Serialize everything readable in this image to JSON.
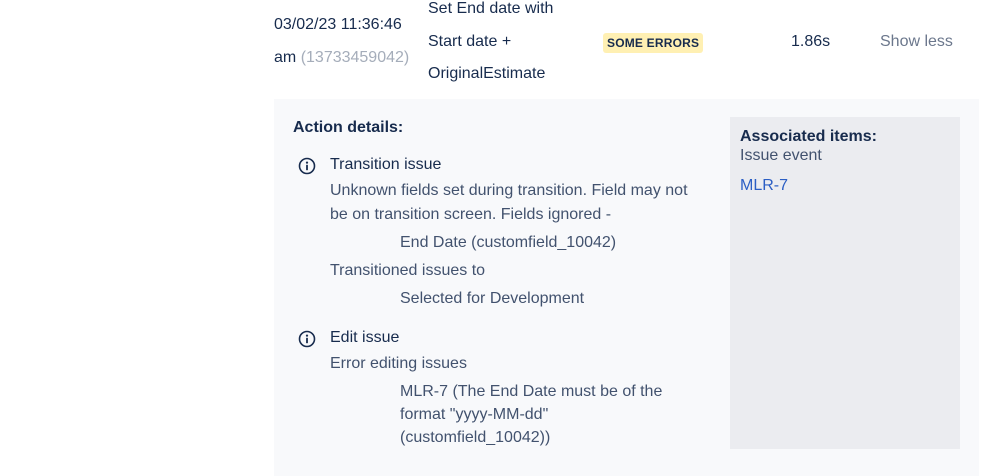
{
  "row": {
    "date": "03/02/23 11:36:46",
    "time_suffix": "am",
    "execution_id": "(13733459042)",
    "rule_name_lines": [
      "Set End date with",
      "Start date +",
      "OriginalEstimate"
    ],
    "status": "SOME ERRORS",
    "duration": "1.86s",
    "toggle_label": "Show less"
  },
  "details": {
    "title": "Action details:",
    "actions": [
      {
        "icon": "info-icon",
        "title": "Transition issue",
        "messages": [
          "Unknown fields set during transition. Field may not",
          "be on transition screen. Fields ignored -"
        ],
        "detail1": "End Date (customfield_10042)",
        "message2": "Transitioned issues to",
        "detail2": "Selected for Development"
      },
      {
        "icon": "info-icon",
        "title": "Edit issue",
        "message": "Error editing issues",
        "detail_lines": [
          "MLR-7 (The End Date must be of the",
          "format \"yyyy-MM-dd\"",
          "(customfield_10042))"
        ]
      }
    ]
  },
  "associated": {
    "title": "Associated items:",
    "type": "Issue event",
    "link": "MLR-7"
  },
  "colors": {
    "badge_bg": "#fff0b3",
    "link": "#2b5ec4",
    "panel_bg": "#f8f9fb",
    "assoc_bg": "#ebecf0"
  }
}
